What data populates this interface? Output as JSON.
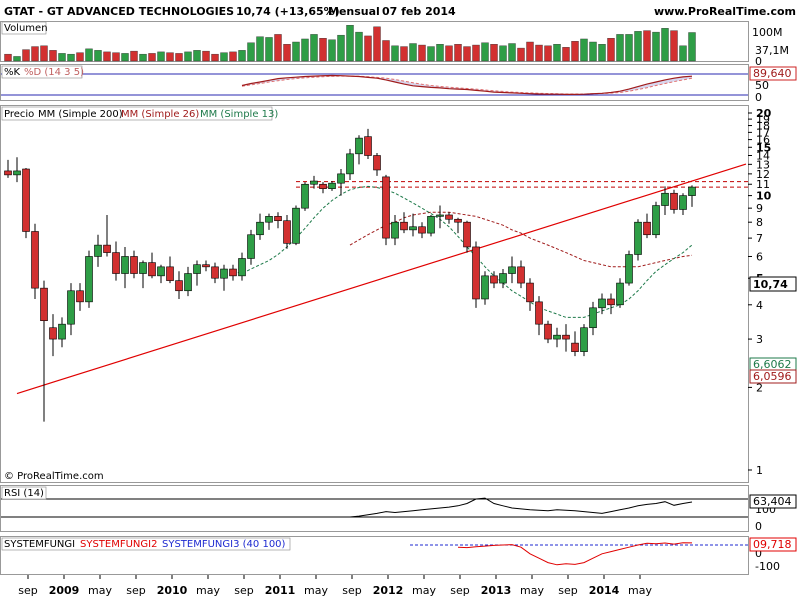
{
  "header": {
    "title": "GTAT - GT ADVANCED TECHNOLOGIES",
    "price_change": "10,74 (+13,65%)",
    "period": "Mensual",
    "date": "07 feb 2014",
    "site": "www.ProRealTime.com"
  },
  "volume_panel": {
    "label": "Volumen",
    "ticks": [
      "100M",
      "37,1M",
      "0"
    ],
    "colors": {
      "up": "#2e9e46",
      "down": "#d23030"
    }
  },
  "stoch_panel": {
    "label_k": "%K",
    "label_d": "%D (14 3 5)",
    "ticks": [
      "100",
      "50",
      "0"
    ],
    "value": "89,640"
  },
  "price_panel": {
    "legend": [
      "Precio",
      "MM (Simple 200)",
      "MM (Simple 26)",
      "MM (Simple 13)"
    ],
    "ticks": [
      {
        "label": "20",
        "v": 20,
        "bold": true
      },
      {
        "label": "19",
        "v": 19
      },
      {
        "label": "18",
        "v": 18
      },
      {
        "label": "17",
        "v": 17
      },
      {
        "label": "16",
        "v": 16
      },
      {
        "label": "15",
        "v": 15,
        "bold": true
      },
      {
        "label": "14",
        "v": 14
      },
      {
        "label": "13",
        "v": 13
      },
      {
        "label": "12",
        "v": 12
      },
      {
        "label": "11",
        "v": 11
      },
      {
        "label": "10",
        "v": 10,
        "bold": true
      },
      {
        "label": "9",
        "v": 9
      },
      {
        "label": "8",
        "v": 8
      },
      {
        "label": "7",
        "v": 7
      },
      {
        "label": "6",
        "v": 6
      },
      {
        "label": "5",
        "v": 5,
        "bold": true
      },
      {
        "label": "4",
        "v": 4
      },
      {
        "label": "3",
        "v": 3
      },
      {
        "label": "2",
        "v": 2
      },
      {
        "label": "1",
        "v": 1
      }
    ],
    "price_tag": "10,74",
    "ma13_tag": "6,6062",
    "ma26_tag": "6,0596",
    "copyright": "© ProRealTime.com"
  },
  "rsi_panel": {
    "label": "RSI (14)",
    "ticks": [
      "100",
      "0"
    ],
    "value": "63,404"
  },
  "fungi_panel": {
    "labels": [
      "SYSTEMFUNGI",
      "SYSTEMFUNGI2",
      "SYSTEMFUNGI3 (40 100)"
    ],
    "ticks": [
      "0",
      "-100"
    ],
    "value": "09,718"
  },
  "x_axis": {
    "labels": [
      {
        "label": "sep",
        "i": 0,
        "bold": false
      },
      {
        "label": "2009",
        "i": 4,
        "bold": true
      },
      {
        "label": "may",
        "i": 8,
        "bold": false
      },
      {
        "label": "sep",
        "i": 12,
        "bold": false
      },
      {
        "label": "2010",
        "i": 16,
        "bold": true
      },
      {
        "label": "may",
        "i": 20,
        "bold": false
      },
      {
        "label": "sep",
        "i": 24,
        "bold": false
      },
      {
        "label": "2011",
        "i": 28,
        "bold": true
      },
      {
        "label": "may",
        "i": 32,
        "bold": false
      },
      {
        "label": "sep",
        "i": 36,
        "bold": false
      },
      {
        "label": "2012",
        "i": 40,
        "bold": true
      },
      {
        "label": "may",
        "i": 44,
        "bold": false
      },
      {
        "label": "sep",
        "i": 48,
        "bold": false
      },
      {
        "label": "2013",
        "i": 52,
        "bold": true
      },
      {
        "label": "may",
        "i": 56,
        "bold": false
      },
      {
        "label": "sep",
        "i": 60,
        "bold": false
      },
      {
        "label": "2014",
        "i": 64,
        "bold": true
      },
      {
        "label": "may",
        "i": 68,
        "bold": false
      }
    ]
  },
  "chart_data": {
    "type": "candlestick",
    "series_colors": {
      "up": "#2e9e46",
      "down": "#d23030",
      "ma200": "#000000",
      "ma26": "#a01c1c",
      "ma13": "#1e7a4a",
      "trend": "#e00000",
      "resistance": "#c00000"
    },
    "candles": [
      {
        "o": 12.3,
        "h": 13.5,
        "l": 11.6,
        "c": 11.9
      },
      {
        "o": 11.9,
        "h": 13.8,
        "l": 11.2,
        "c": 12.3
      },
      {
        "o": 12.5,
        "h": 12.6,
        "l": 7.0,
        "c": 7.4
      },
      {
        "o": 7.4,
        "h": 7.9,
        "l": 4.2,
        "c": 4.6
      },
      {
        "o": 4.6,
        "h": 4.9,
        "l": 1.5,
        "c": 3.5
      },
      {
        "o": 3.3,
        "h": 3.7,
        "l": 2.6,
        "c": 3.0
      },
      {
        "o": 3.0,
        "h": 3.6,
        "l": 2.8,
        "c": 3.4
      },
      {
        "o": 3.4,
        "h": 4.8,
        "l": 3.1,
        "c": 4.5
      },
      {
        "o": 4.5,
        "h": 4.8,
        "l": 3.8,
        "c": 4.1
      },
      {
        "o": 4.1,
        "h": 6.3,
        "l": 3.9,
        "c": 6.0
      },
      {
        "o": 6.0,
        "h": 7.2,
        "l": 5.5,
        "c": 6.6
      },
      {
        "o": 6.6,
        "h": 8.5,
        "l": 6.0,
        "c": 6.2
      },
      {
        "o": 6.2,
        "h": 6.8,
        "l": 4.9,
        "c": 5.2
      },
      {
        "o": 5.2,
        "h": 6.5,
        "l": 4.6,
        "c": 6.0
      },
      {
        "o": 6.0,
        "h": 6.3,
        "l": 5.0,
        "c": 5.2
      },
      {
        "o": 5.2,
        "h": 5.8,
        "l": 4.6,
        "c": 5.7
      },
      {
        "o": 5.7,
        "h": 6.2,
        "l": 5.0,
        "c": 5.1
      },
      {
        "o": 5.1,
        "h": 5.6,
        "l": 4.8,
        "c": 5.5
      },
      {
        "o": 5.5,
        "h": 6.0,
        "l": 4.8,
        "c": 4.9
      },
      {
        "o": 4.9,
        "h": 5.3,
        "l": 4.2,
        "c": 4.5
      },
      {
        "o": 4.5,
        "h": 5.5,
        "l": 4.3,
        "c": 5.2
      },
      {
        "o": 5.2,
        "h": 5.8,
        "l": 4.7,
        "c": 5.6
      },
      {
        "o": 5.6,
        "h": 5.8,
        "l": 5.3,
        "c": 5.5
      },
      {
        "o": 5.5,
        "h": 5.7,
        "l": 4.8,
        "c": 5.0
      },
      {
        "o": 5.0,
        "h": 5.6,
        "l": 4.5,
        "c": 5.4
      },
      {
        "o": 5.4,
        "h": 5.6,
        "l": 4.9,
        "c": 5.1
      },
      {
        "o": 5.1,
        "h": 6.2,
        "l": 4.9,
        "c": 5.9
      },
      {
        "o": 5.9,
        "h": 7.5,
        "l": 5.6,
        "c": 7.2
      },
      {
        "o": 7.2,
        "h": 8.6,
        "l": 6.9,
        "c": 8.0
      },
      {
        "o": 8.0,
        "h": 8.6,
        "l": 7.5,
        "c": 8.4
      },
      {
        "o": 8.4,
        "h": 8.7,
        "l": 7.6,
        "c": 8.1
      },
      {
        "o": 8.1,
        "h": 8.5,
        "l": 6.4,
        "c": 6.7
      },
      {
        "o": 6.7,
        "h": 9.2,
        "l": 6.6,
        "c": 9.0
      },
      {
        "o": 9.0,
        "h": 11.2,
        "l": 8.8,
        "c": 11.0
      },
      {
        "o": 11.0,
        "h": 11.8,
        "l": 10.6,
        "c": 11.3
      },
      {
        "o": 11.0,
        "h": 11.2,
        "l": 10.2,
        "c": 10.6
      },
      {
        "o": 10.6,
        "h": 11.3,
        "l": 10.4,
        "c": 11.1
      },
      {
        "o": 11.1,
        "h": 12.5,
        "l": 10.0,
        "c": 12.0
      },
      {
        "o": 12.0,
        "h": 14.8,
        "l": 11.4,
        "c": 14.2
      },
      {
        "o": 14.2,
        "h": 16.6,
        "l": 13.0,
        "c": 16.2
      },
      {
        "o": 16.4,
        "h": 17.5,
        "l": 13.6,
        "c": 14.0
      },
      {
        "o": 14.0,
        "h": 14.3,
        "l": 11.8,
        "c": 12.4
      },
      {
        "o": 11.7,
        "h": 11.9,
        "l": 6.6,
        "c": 7.0
      },
      {
        "o": 7.0,
        "h": 8.5,
        "l": 6.6,
        "c": 8.0
      },
      {
        "o": 8.0,
        "h": 8.7,
        "l": 7.3,
        "c": 7.5
      },
      {
        "o": 7.5,
        "h": 8.6,
        "l": 7.1,
        "c": 7.7
      },
      {
        "o": 7.7,
        "h": 8.0,
        "l": 7.0,
        "c": 7.3
      },
      {
        "o": 7.3,
        "h": 8.5,
        "l": 7.1,
        "c": 8.4
      },
      {
        "o": 8.4,
        "h": 9.2,
        "l": 7.6,
        "c": 8.5
      },
      {
        "o": 8.5,
        "h": 8.7,
        "l": 7.9,
        "c": 8.2
      },
      {
        "o": 8.2,
        "h": 8.3,
        "l": 7.3,
        "c": 8.0
      },
      {
        "o": 8.0,
        "h": 8.1,
        "l": 6.2,
        "c": 6.5
      },
      {
        "o": 6.5,
        "h": 6.8,
        "l": 3.9,
        "c": 4.2
      },
      {
        "o": 4.2,
        "h": 5.3,
        "l": 4.0,
        "c": 5.1
      },
      {
        "o": 5.1,
        "h": 5.3,
        "l": 4.6,
        "c": 4.8
      },
      {
        "o": 4.8,
        "h": 5.4,
        "l": 4.6,
        "c": 5.2
      },
      {
        "o": 5.2,
        "h": 6.0,
        "l": 4.8,
        "c": 5.5
      },
      {
        "o": 5.5,
        "h": 5.8,
        "l": 4.6,
        "c": 4.8
      },
      {
        "o": 4.8,
        "h": 5.0,
        "l": 3.8,
        "c": 4.1
      },
      {
        "o": 4.1,
        "h": 4.3,
        "l": 3.1,
        "c": 3.4
      },
      {
        "o": 3.4,
        "h": 3.5,
        "l": 2.9,
        "c": 3.0
      },
      {
        "o": 3.0,
        "h": 3.3,
        "l": 2.8,
        "c": 3.1
      },
      {
        "o": 3.1,
        "h": 3.4,
        "l": 2.7,
        "c": 3.0
      },
      {
        "o": 2.9,
        "h": 3.2,
        "l": 2.6,
        "c": 2.7
      },
      {
        "o": 2.7,
        "h": 3.4,
        "l": 2.6,
        "c": 3.3
      },
      {
        "o": 3.3,
        "h": 4.1,
        "l": 3.1,
        "c": 3.9
      },
      {
        "o": 3.9,
        "h": 4.4,
        "l": 3.7,
        "c": 4.2
      },
      {
        "o": 4.2,
        "h": 4.4,
        "l": 3.7,
        "c": 4.0
      },
      {
        "o": 4.0,
        "h": 5.0,
        "l": 3.9,
        "c": 4.8
      },
      {
        "o": 4.8,
        "h": 6.3,
        "l": 4.7,
        "c": 6.1
      },
      {
        "o": 6.1,
        "h": 8.2,
        "l": 5.8,
        "c": 8.0
      },
      {
        "o": 8.0,
        "h": 8.6,
        "l": 7.0,
        "c": 7.2
      },
      {
        "o": 7.2,
        "h": 9.5,
        "l": 7.0,
        "c": 9.2
      },
      {
        "o": 9.2,
        "h": 10.8,
        "l": 8.5,
        "c": 10.2
      },
      {
        "o": 10.2,
        "h": 10.5,
        "l": 8.6,
        "c": 8.9
      },
      {
        "o": 8.9,
        "h": 10.2,
        "l": 8.5,
        "c": 10.0
      },
      {
        "o": 10.0,
        "h": 10.9,
        "l": 9.1,
        "c": 10.74
      }
    ],
    "volume": [
      18,
      12,
      30,
      38,
      40,
      28,
      20,
      18,
      22,
      32,
      28,
      24,
      22,
      20,
      26,
      18,
      20,
      24,
      22,
      20,
      24,
      28,
      26,
      18,
      22,
      24,
      28,
      48,
      64,
      62,
      70,
      44,
      50,
      58,
      70,
      60,
      56,
      68,
      94,
      76,
      66,
      90,
      54,
      40,
      38,
      46,
      42,
      38,
      44,
      40,
      44,
      38,
      42,
      48,
      44,
      40,
      46,
      34,
      50,
      42,
      40,
      44,
      36,
      52,
      58,
      50,
      44,
      60,
      70,
      70,
      78,
      80,
      76,
      86,
      80,
      40,
      75
    ],
    "ma13": [
      null,
      null,
      null,
      null,
      null,
      null,
      null,
      null,
      null,
      null,
      null,
      null,
      null,
      null,
      null,
      null,
      null,
      null,
      null,
      null,
      null,
      null,
      null,
      null,
      null,
      5.3,
      5.2,
      5.4,
      5.6,
      5.8,
      6.1,
      6.5,
      7.0,
      7.6,
      8.3,
      9.0,
      9.6,
      10.1,
      10.5,
      10.7,
      10.8,
      10.7,
      10.5,
      10.2,
      9.8,
      9.4,
      9.0,
      8.6,
      8.2,
      7.7,
      7.1,
      6.5,
      6.0,
      5.5,
      5.1,
      4.8,
      4.5,
      4.3,
      4.1,
      3.9,
      3.8,
      3.7,
      3.6,
      3.6,
      3.6,
      3.7,
      3.8,
      3.9,
      4.0,
      4.2,
      4.5,
      4.9,
      5.3,
      5.6,
      5.9,
      6.2,
      6.6062
    ],
    "ma26": [
      null,
      null,
      null,
      null,
      null,
      null,
      null,
      null,
      null,
      null,
      null,
      null,
      null,
      null,
      null,
      null,
      null,
      null,
      null,
      null,
      null,
      null,
      null,
      null,
      null,
      null,
      null,
      null,
      null,
      null,
      null,
      null,
      null,
      null,
      null,
      null,
      null,
      null,
      6.6,
      6.9,
      7.2,
      7.5,
      7.8,
      8.0,
      8.3,
      8.5,
      8.6,
      8.7,
      8.7,
      8.7,
      8.6,
      8.5,
      8.4,
      8.2,
      8.0,
      7.8,
      7.5,
      7.3,
      7.0,
      6.8,
      6.6,
      6.4,
      6.2,
      6.0,
      5.8,
      5.7,
      5.6,
      5.5,
      5.5,
      5.5,
      5.5,
      5.6,
      5.7,
      5.8,
      5.9,
      6.0,
      6.0596
    ],
    "trendline": [
      {
        "i": 1,
        "v": 1.9
      },
      {
        "i": 76,
        "v": 11.3
      }
    ],
    "resistance": [
      11.25,
      10.74
    ],
    "stoch_k": [
      null,
      null,
      null,
      null,
      null,
      null,
      null,
      null,
      null,
      null,
      null,
      null,
      null,
      null,
      null,
      null,
      null,
      null,
      null,
      null,
      null,
      null,
      null,
      null,
      null,
      null,
      45,
      55,
      62,
      70,
      78,
      82,
      85,
      88,
      90,
      92,
      93,
      92,
      90,
      88,
      84,
      80,
      72,
      62,
      52,
      44,
      40,
      36,
      34,
      30,
      28,
      26,
      22,
      18,
      14,
      12,
      10,
      8,
      6,
      5,
      4,
      4,
      3,
      3,
      4,
      6,
      8,
      12,
      18,
      28,
      40,
      52,
      62,
      72,
      80,
      86,
      89.64
    ],
    "stoch_d": [
      null,
      null,
      null,
      null,
      null,
      null,
      null,
      null,
      null,
      null,
      null,
      null,
      null,
      null,
      null,
      null,
      null,
      null,
      null,
      null,
      null,
      null,
      null,
      null,
      null,
      null,
      42,
      48,
      55,
      62,
      68,
      74,
      78,
      82,
      85,
      87,
      89,
      90,
      90,
      89,
      87,
      84,
      80,
      74,
      66,
      58,
      51,
      45,
      41,
      37,
      34,
      31,
      28,
      24,
      20,
      17,
      14,
      12,
      10,
      8,
      7,
      6,
      5,
      5,
      5,
      6,
      7,
      9,
      12,
      18,
      26,
      35,
      45,
      55,
      64,
      72,
      80
    ],
    "rsi": [
      null,
      null,
      null,
      null,
      null,
      null,
      null,
      null,
      null,
      null,
      null,
      null,
      null,
      null,
      null,
      null,
      null,
      null,
      null,
      null,
      null,
      null,
      null,
      null,
      null,
      null,
      null,
      null,
      null,
      null,
      null,
      null,
      null,
      null,
      null,
      null,
      null,
      null,
      30,
      32,
      35,
      38,
      42,
      40,
      42,
      44,
      46,
      48,
      50,
      52,
      55,
      60,
      70,
      72,
      60,
      55,
      50,
      48,
      46,
      45,
      44,
      46,
      45,
      44,
      42,
      40,
      38,
      42,
      46,
      50,
      55,
      58,
      60,
      64,
      56,
      60,
      63.404
    ],
    "fungi": [
      null,
      null,
      null,
      null,
      null,
      null,
      null,
      null,
      null,
      null,
      null,
      null,
      null,
      null,
      null,
      null,
      null,
      null,
      null,
      null,
      null,
      null,
      null,
      null,
      null,
      null,
      null,
      null,
      null,
      null,
      null,
      null,
      null,
      null,
      null,
      null,
      null,
      null,
      null,
      null,
      null,
      null,
      null,
      null,
      null,
      null,
      null,
      null,
      null,
      null,
      -10,
      -12,
      -8,
      -5,
      -2,
      0,
      2,
      -10,
      -40,
      -60,
      -80,
      -90,
      -85,
      -88,
      -80,
      -60,
      -40,
      -30,
      -20,
      -10,
      0,
      8,
      6,
      9,
      4,
      10,
      9.718
    ],
    "fungi_ref": 0
  }
}
